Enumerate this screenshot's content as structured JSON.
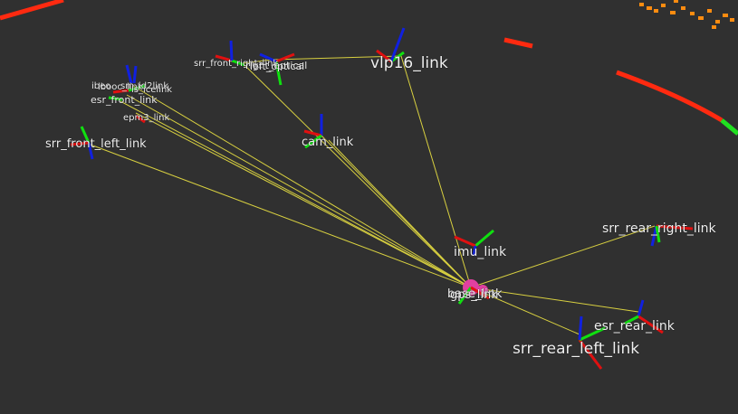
{
  "colors": {
    "background": "#303030",
    "tf_line": "#d8d040",
    "axis_x": "#e01010",
    "axis_y": "#10e010",
    "axis_z": "#1020e0",
    "scan_red": "#ff2a10",
    "scan_orange": "#ff8c10",
    "scan_green": "#20e020",
    "base_marker": "#e040a0"
  },
  "frames": [
    {
      "id": "vlp16",
      "label": "vlp16_link"
    },
    {
      "id": "srr_front_right",
      "label": "srr_front_right_link"
    },
    {
      "id": "right_optical",
      "label": "right_optical"
    },
    {
      "id": "left_optical",
      "label": "left_optical"
    },
    {
      "id": "ibeo",
      "label": "ibeo"
    },
    {
      "id": "esr_front",
      "label": "esr_front_link"
    },
    {
      "id": "epm3",
      "label": "epm3_link"
    },
    {
      "id": "srr_front_left",
      "label": "srr_front_left_link"
    },
    {
      "id": "cam",
      "label": "cam_link"
    },
    {
      "id": "imu",
      "label": "imu_link"
    },
    {
      "id": "base",
      "label": "base_link"
    },
    {
      "id": "gps",
      "label": "gps_link"
    },
    {
      "id": "srr_rear_right",
      "label": "srr_rear_right_link"
    },
    {
      "id": "esr_rear",
      "label": "esr_rear_link"
    },
    {
      "id": "srr_rear_left",
      "label": "srr_rear_left_link"
    }
  ],
  "labels": {
    "cluster_a": "lbooc_link",
    "cluster_b": "sm_id2link",
    "cluster_c": "ls_icelink"
  }
}
